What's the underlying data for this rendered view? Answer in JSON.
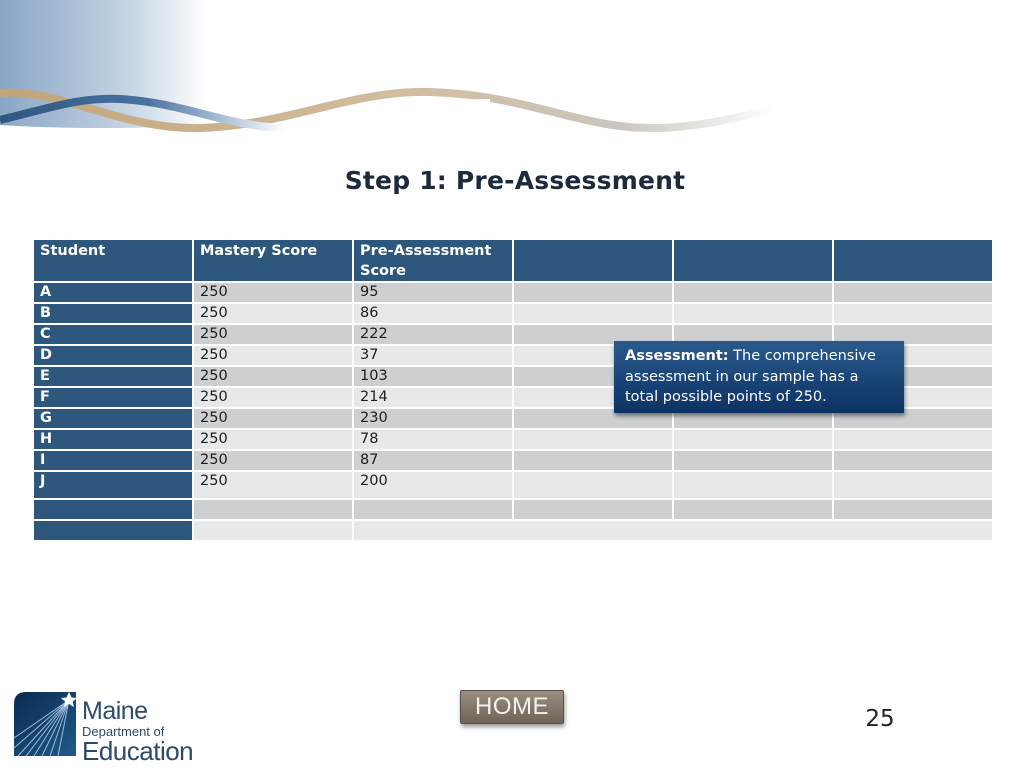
{
  "slide": {
    "title": "Step 1: Pre-Assessment",
    "page_number": "25"
  },
  "table": {
    "headers": [
      "Student",
      "Mastery Score",
      "Pre-Assessment Score",
      "",
      "",
      ""
    ],
    "rows": [
      {
        "student": "A",
        "mastery": "250",
        "pre": "95"
      },
      {
        "student": "B",
        "mastery": "250",
        "pre": "86"
      },
      {
        "student": "C",
        "mastery": "250",
        "pre": "222"
      },
      {
        "student": "D",
        "mastery": "250",
        "pre": "37"
      },
      {
        "student": "E",
        "mastery": "250",
        "pre": "103"
      },
      {
        "student": "F",
        "mastery": "250",
        "pre": "214"
      },
      {
        "student": "G",
        "mastery": "250",
        "pre": "230"
      },
      {
        "student": "H",
        "mastery": "250",
        "pre": "78"
      },
      {
        "student": "I",
        "mastery": "250",
        "pre": "87"
      },
      {
        "student": "J",
        "mastery": "250",
        "pre": "200"
      }
    ]
  },
  "callout": {
    "label": "Assessment:",
    "text": " The comprehensive assessment in our sample has a total possible points of 250."
  },
  "logo": {
    "line1": "Maine",
    "line2": "Department of",
    "line3": "Education"
  },
  "nav": {
    "home_label": "HOME"
  },
  "colors": {
    "header_blue": "#2d577d",
    "row_dark": "#cdcfd2",
    "row_light": "#e7e8e9",
    "callout_blue": "#1a4678",
    "home_button": "#857a6d"
  }
}
